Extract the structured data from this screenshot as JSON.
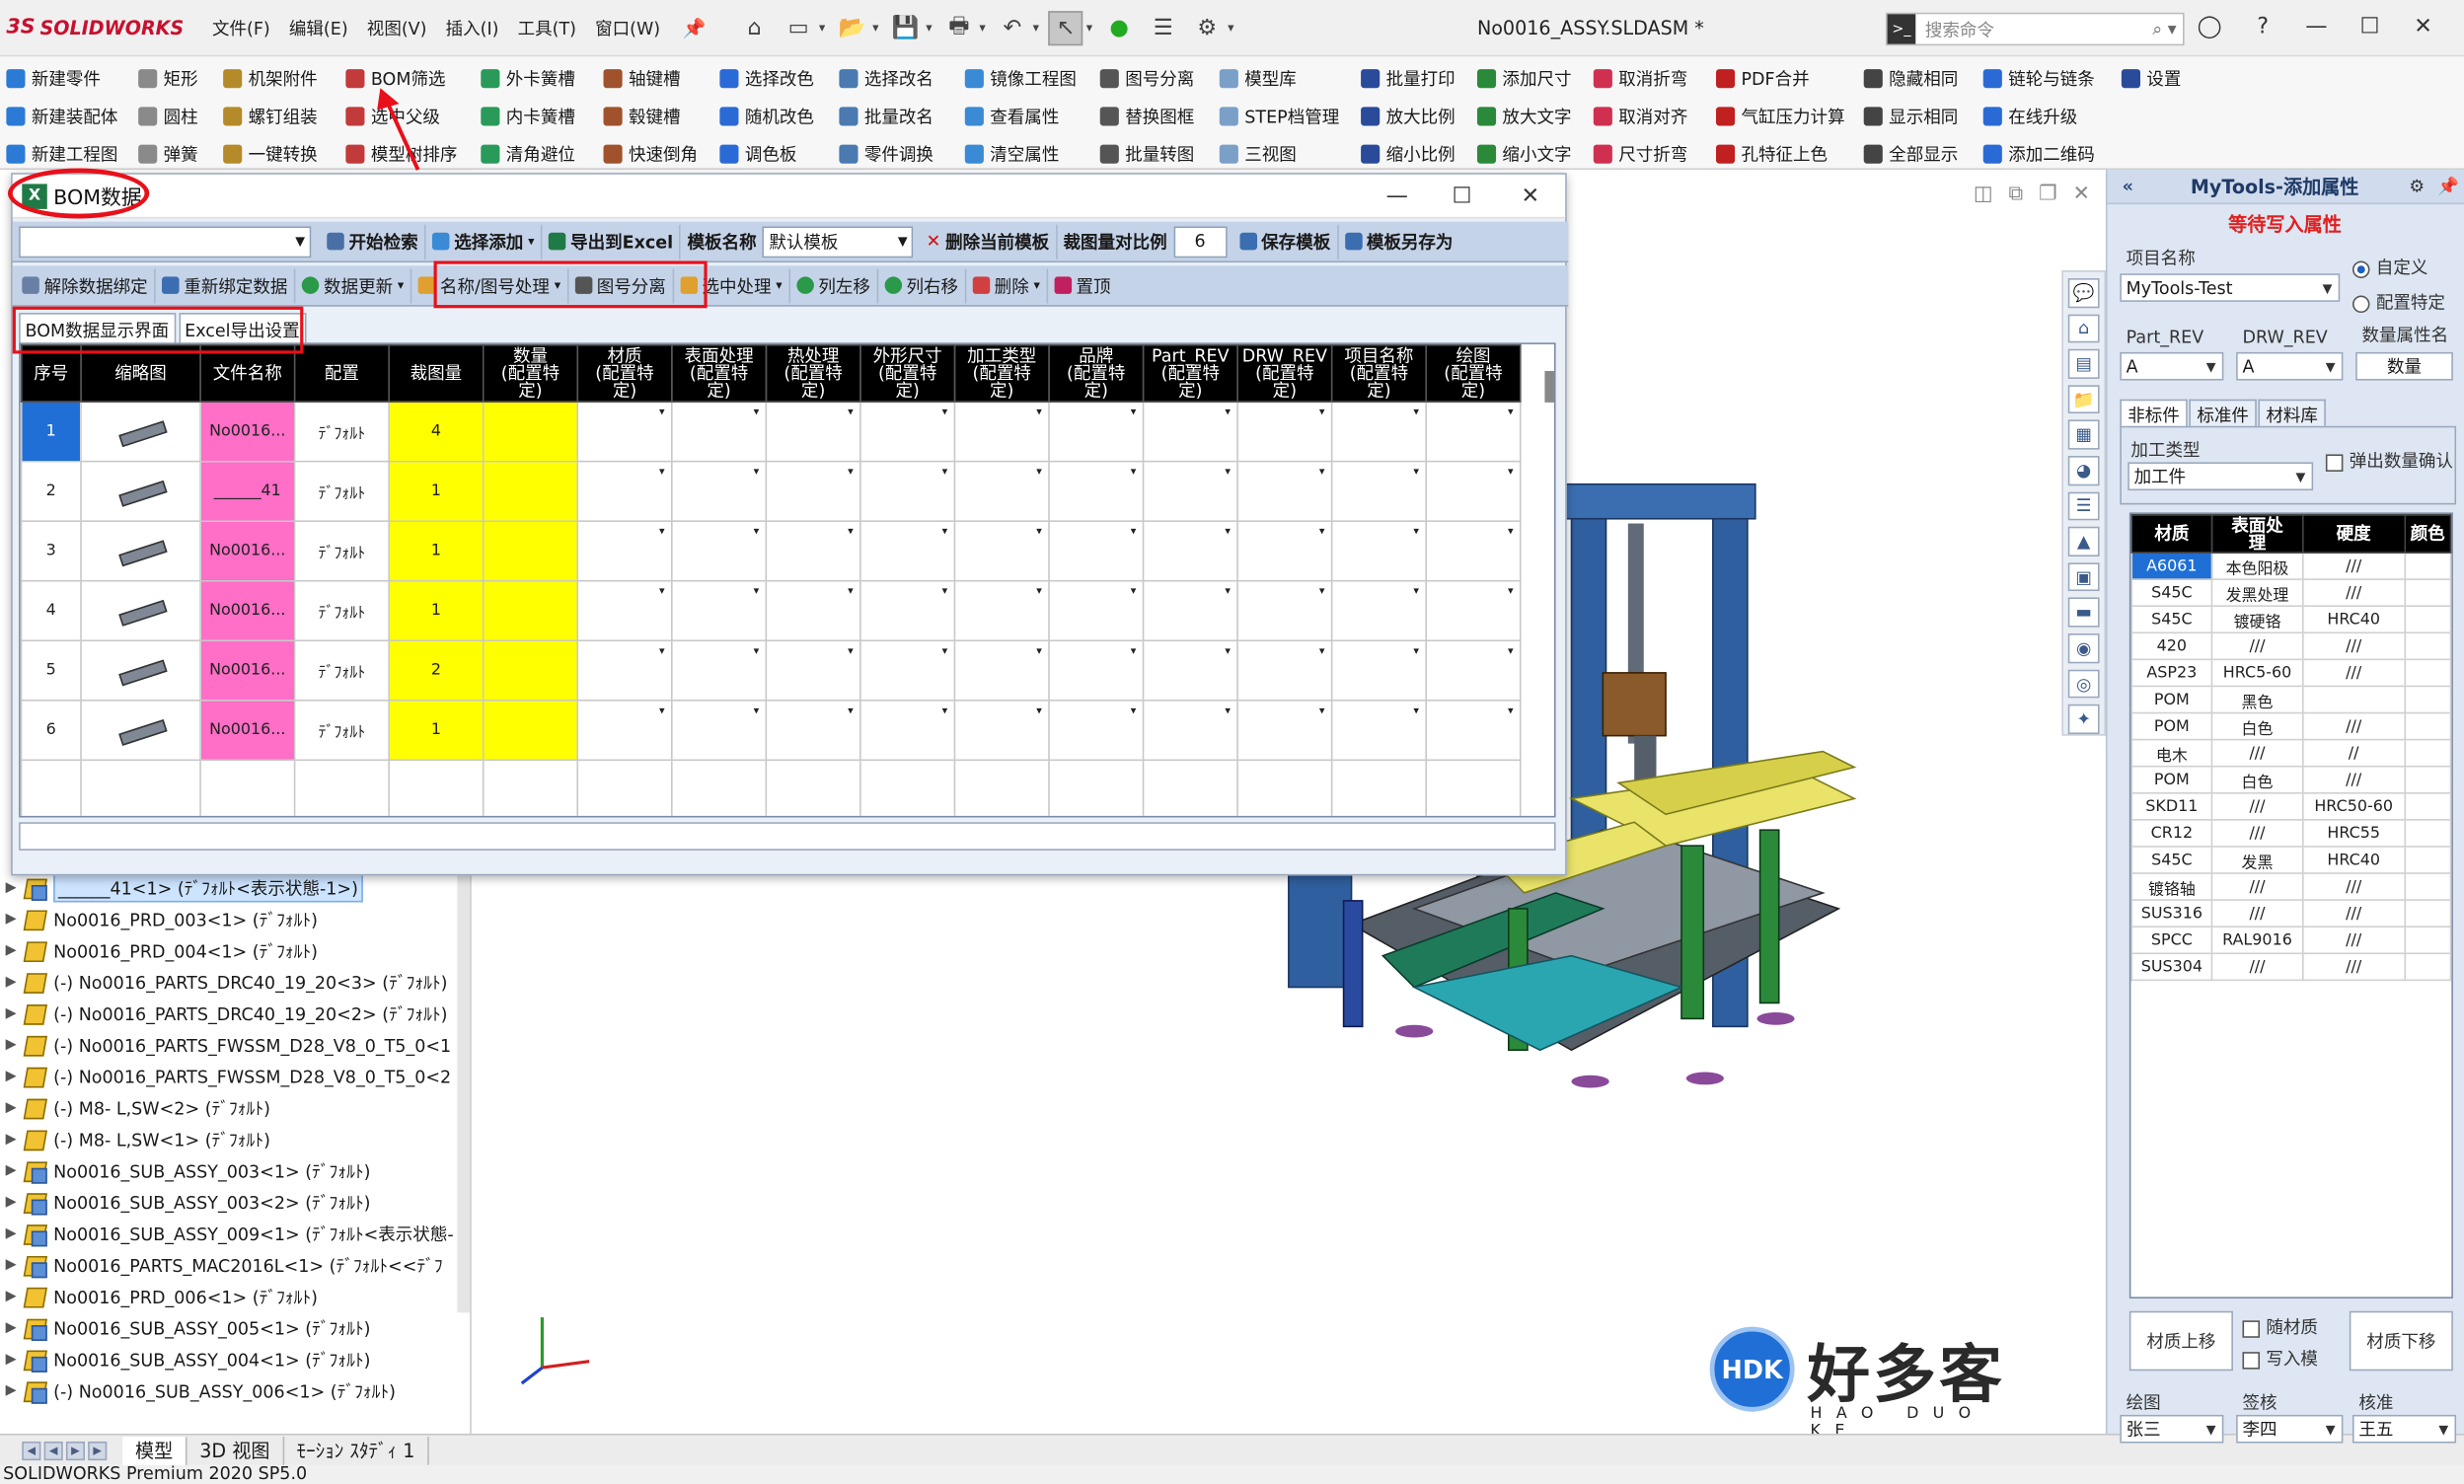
{
  "app": {
    "brand": "SOLIDWORKS",
    "menu": [
      "文件(F)",
      "编辑(E)",
      "视图(V)",
      "插入(I)",
      "工具(T)",
      "窗口(W)"
    ],
    "doc_title": "No0016_ASSY.SLDASM *",
    "search_placeholder": "搜索命令",
    "status": "SOLIDWORKS Premium 2020 SP5.0",
    "bottom_tabs": [
      "模型",
      "3D 视图",
      "ﾓｰｼｮﾝ ｽﾀﾃﾞｨ 1"
    ]
  },
  "ribbon": [
    [
      "新建零件",
      "新建装配体",
      "新建工程图"
    ],
    [
      "矩形",
      "圆柱",
      "弹簧"
    ],
    [
      "机架附件",
      "螺钉组装",
      "一键转换"
    ],
    [
      "BOM筛选",
      "选中父级",
      "模型树排序"
    ],
    [
      "外卡簧槽",
      "内卡簧槽",
      "清角避位"
    ],
    [
      "轴键槽",
      "毂键槽",
      "快速倒角"
    ],
    [
      "选择改色",
      "随机改色",
      "调色板"
    ],
    [
      "选择改名",
      "批量改名",
      "零件调换"
    ],
    [
      "镜像工程图",
      "查看属性",
      "清空属性"
    ],
    [
      "图号分离",
      "替换图框",
      "批量转图"
    ],
    [
      "模型库",
      "STEP档管理",
      "三视图"
    ],
    [
      "批量打印",
      "放大比例",
      "缩小比例"
    ],
    [
      "添加尺寸",
      "放大文字",
      "缩小文字"
    ],
    [
      "取消折弯",
      "取消对齐",
      "尺寸折弯"
    ],
    [
      "PDF合并",
      "气缸压力计算",
      "孔特征上色"
    ],
    [
      "隐藏相同",
      "显示相同",
      "全部显示"
    ],
    [
      "链轮与链条",
      "在线升级",
      "添加二维码"
    ],
    [
      "设置",
      "",
      ""
    ]
  ],
  "bom": {
    "title": "BOM数据",
    "toolbar1": {
      "search": "开始检索",
      "select_add": "选择添加",
      "export": "导出到Excel",
      "template_label": "模板名称",
      "template_value": "默认模板",
      "delete_template": "删除当前模板",
      "ratio_label": "裁图量对比例",
      "ratio_value": "6",
      "save_template": "保存模板",
      "save_as": "模板另存为"
    },
    "toolbar2": {
      "unbind": "解除数据绑定",
      "rebind": "重新绑定数据",
      "update": "数据更新",
      "name_process": "名称/图号处理",
      "split": "图号分离",
      "select_process": "选中处理",
      "move_left": "列左移",
      "move_right": "列右移",
      "delete": "删除",
      "top": "置顶"
    },
    "tabs": [
      "BOM数据显示界面",
      "Excel导出设置"
    ],
    "columns": [
      "序号",
      "缩略图",
      "文件名称",
      "配置",
      "裁图量",
      "数量\n(配置特\n定)",
      "材质\n(配置特\n定)",
      "表面处理\n(配置特\n定)",
      "热处理\n(配置特\n定)",
      "外形尺寸\n(配置特\n定)",
      "加工类型\n(配置特\n定)",
      "品牌\n(配置特\n定)",
      "Part_REV\n(配置特\n定)",
      "DRW_REV\n(配置特\n定)",
      "项目名称\n(配置特\n定)",
      "绘图\n(配置特\n定)"
    ],
    "rows": [
      {
        "no": "1",
        "file": "No0016...",
        "config": "ﾃﾞﾌｫﾙﾄ",
        "qty": "4"
      },
      {
        "no": "2",
        "file": "______41",
        "config": "ﾃﾞﾌｫﾙﾄ",
        "qty": "1"
      },
      {
        "no": "3",
        "file": "No0016...",
        "config": "ﾃﾞﾌｫﾙﾄ",
        "qty": "1"
      },
      {
        "no": "4",
        "file": "No0016...",
        "config": "ﾃﾞﾌｫﾙﾄ",
        "qty": "1"
      },
      {
        "no": "5",
        "file": "No0016...",
        "config": "ﾃﾞﾌｫﾙﾄ",
        "qty": "2"
      },
      {
        "no": "6",
        "file": "No0016...",
        "config": "ﾃﾞﾌｫﾙﾄ",
        "qty": "1"
      }
    ]
  },
  "tree": [
    "______41<1> (ﾃﾞﾌｫﾙﾄ<表示状態-1>)",
    "No0016_PRD_003<1> (ﾃﾞﾌｫﾙﾄ)",
    "No0016_PRD_004<1> (ﾃﾞﾌｫﾙﾄ)",
    "(-) No0016_PARTS_DRC40_19_20<3> (ﾃﾞﾌｫﾙﾄ)",
    "(-) No0016_PARTS_DRC40_19_20<2> (ﾃﾞﾌｫﾙﾄ)",
    "(-) No0016_PARTS_FWSSM_D28_V8_0_T5_0<1",
    "(-) No0016_PARTS_FWSSM_D28_V8_0_T5_0<2",
    "(-) M8-  L,SW<2> (ﾃﾞﾌｫﾙﾄ)",
    "(-) M8-  L,SW<1> (ﾃﾞﾌｫﾙﾄ)",
    "No0016_SUB_ASSY_003<1> (ﾃﾞﾌｫﾙﾄ)",
    "No0016_SUB_ASSY_003<2> (ﾃﾞﾌｫﾙﾄ)",
    "No0016_SUB_ASSY_009<1> (ﾃﾞﾌｫﾙﾄ<表示状態-",
    "No0016_PARTS_MAC2016L<1> (ﾃﾞﾌｫﾙﾄ<<ﾃﾞﾌ",
    "No0016_PRD_006<1> (ﾃﾞﾌｫﾙﾄ)",
    "No0016_SUB_ASSY_005<1> (ﾃﾞﾌｫﾙﾄ)",
    "No0016_SUB_ASSY_004<1> (ﾃﾞﾌｫﾙﾄ)",
    "(-) No0016_SUB_ASSY_006<1> (ﾃﾞﾌｫﾙﾄ)"
  ],
  "rpanel": {
    "title": "MyTools-添加属性",
    "pending": "等待写入属性",
    "project_label": "项目名称",
    "project_value": "MyTools-Test",
    "radio_custom": "自定义",
    "radio_config": "配置特定",
    "part_rev_label": "Part_REV",
    "part_rev_value": "A",
    "drw_rev_label": "DRW_REV",
    "drw_rev_value": "A",
    "qty_attr_label": "数量属性名",
    "qty_attr_value": "数量",
    "tabs": [
      "非标件",
      "标准件",
      "材料库"
    ],
    "proc_label": "加工类型",
    "proc_value": "加工件",
    "popup_check": "弹出数量确认",
    "mat_headers": [
      "材质",
      "表面处\n理",
      "硬度",
      "颜色"
    ],
    "materials": [
      [
        "A6061",
        "本色阳极",
        "///",
        ""
      ],
      [
        "S45C",
        "发黑处理",
        "///",
        ""
      ],
      [
        "S45C",
        "镀硬铬",
        "HRC40",
        ""
      ],
      [
        "420",
        "///",
        "///",
        ""
      ],
      [
        "ASP23",
        "HRC5-60",
        "///",
        ""
      ],
      [
        "POM",
        "黑色",
        "",
        ""
      ],
      [
        "POM",
        "白色",
        "///",
        ""
      ],
      [
        "电木",
        "///",
        "//",
        ""
      ],
      [
        "POM",
        "白色",
        "///",
        ""
      ],
      [
        "SKD11",
        "///",
        "HRC50-60",
        ""
      ],
      [
        "CR12",
        "///",
        "HRC55",
        ""
      ],
      [
        "S45C",
        "发黑",
        "HRC40",
        ""
      ],
      [
        "镀铬轴",
        "///",
        "///",
        ""
      ],
      [
        "SUS316",
        "///",
        "///",
        ""
      ],
      [
        "SPCC",
        "RAL9016",
        "///",
        ""
      ],
      [
        "SUS304",
        "///",
        "///",
        ""
      ]
    ],
    "btn_up": "材质上移",
    "btn_down": "材质下移",
    "chk_follow": "随材质",
    "chk_mold": "写入模",
    "draw_label": "绘图",
    "draw_value": "张三",
    "sign_label": "签核",
    "sign_value": "李四",
    "approve_label": "核准",
    "approve_value": "王五"
  },
  "watermark": {
    "logo": "HDK",
    "name": "好多客",
    "pinyin": "HAO DUO KE"
  }
}
